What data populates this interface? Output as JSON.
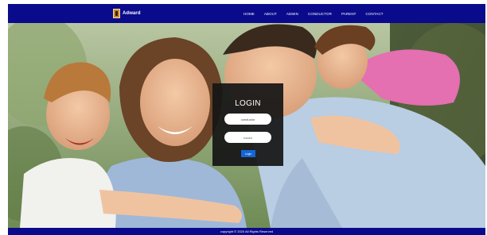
{
  "brand": {
    "name": "Adward",
    "logo_icon": "door-logo-icon"
  },
  "nav": {
    "items": [
      {
        "label": "HOME"
      },
      {
        "label": "ABOUT"
      },
      {
        "label": "ADMIN"
      },
      {
        "label": "CONDUCTOR"
      },
      {
        "label": "PARENT"
      },
      {
        "label": "CONTACT"
      }
    ]
  },
  "login": {
    "title": "LOGIN",
    "username_value": "conductor",
    "password_value": "••••••••",
    "button_label": "Login"
  },
  "footer": {
    "text": "copyright © 2020 All Rights Reserved"
  },
  "colors": {
    "navbar": "#0a0a8c",
    "login_panel": "#161616",
    "button": "#1565d8"
  }
}
